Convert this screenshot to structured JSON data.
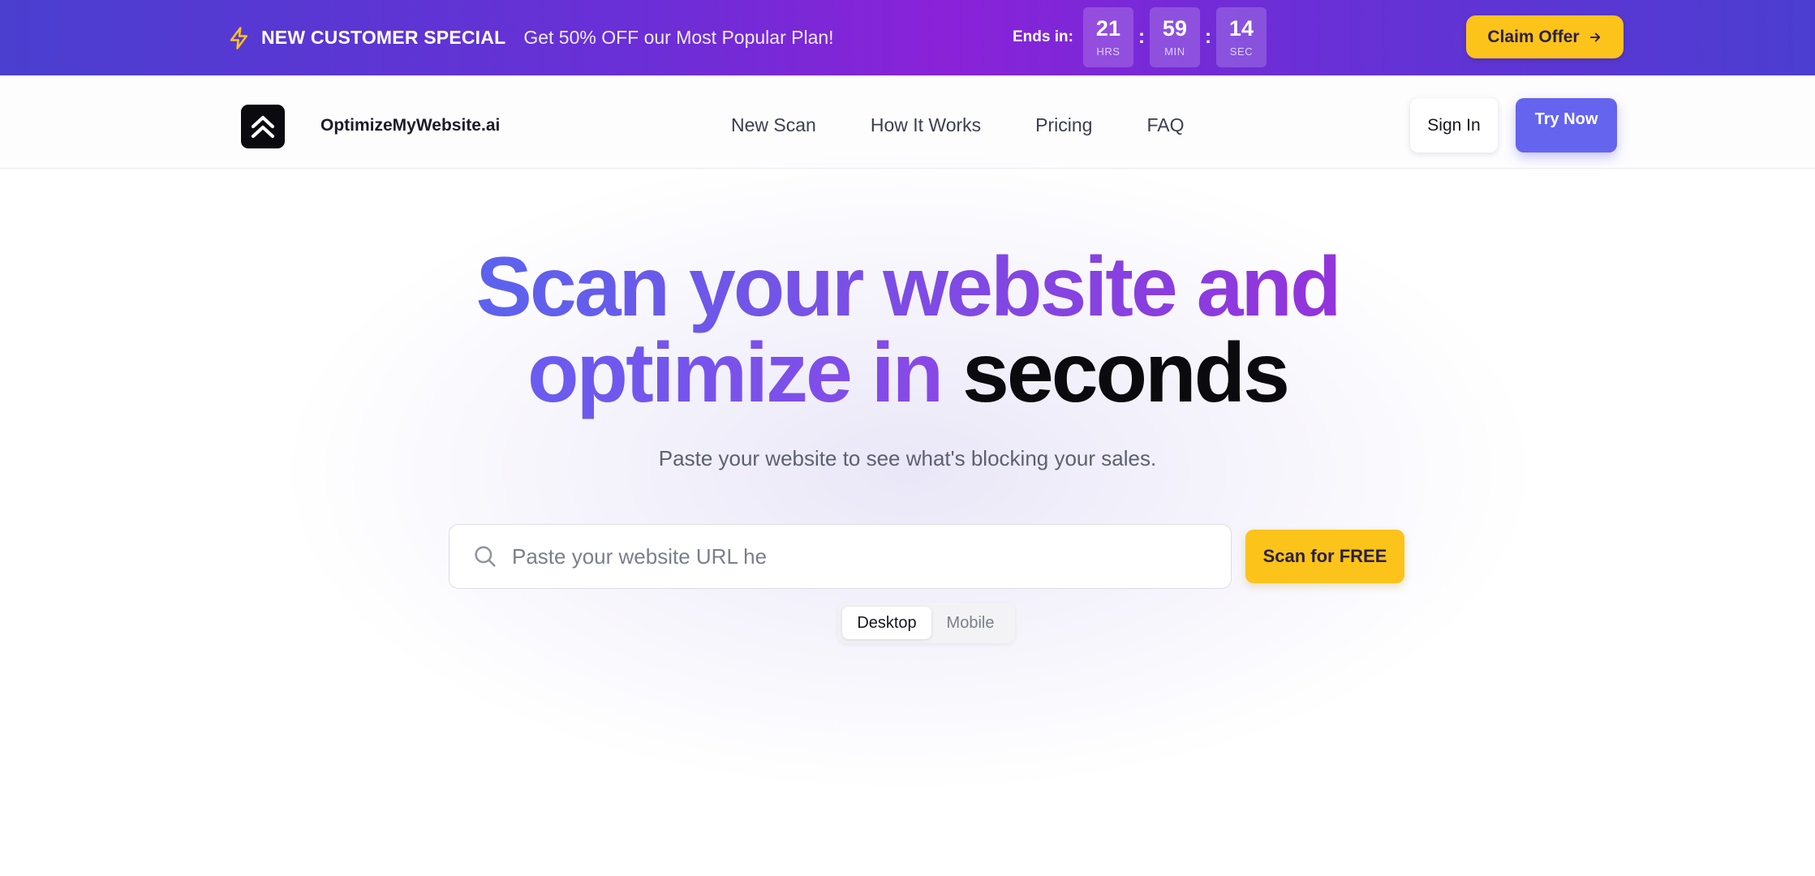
{
  "promo": {
    "tag": "NEW CUSTOMER SPECIAL",
    "text": "Get 50% OFF our Most Popular Plan!",
    "ends_label": "Ends in:",
    "countdown": [
      {
        "value": "21",
        "unit": "HRS"
      },
      {
        "value": "59",
        "unit": "MIN"
      },
      {
        "value": "14",
        "unit": "SEC"
      }
    ],
    "separator": ":",
    "cta_label": "Claim Offer",
    "icons": {
      "tag_icon": "lightning-bolt-icon",
      "cta_icon": "arrow-right-icon"
    }
  },
  "nav": {
    "brand": "OptimizeMyWebsite.ai",
    "logo_icon": "double-chevron-up-icon",
    "links": [
      "New Scan",
      "How It Works",
      "Pricing",
      "FAQ"
    ],
    "signin_label": "Sign In",
    "trynow_label": "Try Now"
  },
  "hero": {
    "headline_line1_a": "Scan your website and",
    "headline_line2_a": "optimize in",
    "headline_line2_b": "seconds",
    "subhead": "Paste your website to see what's blocking your sales.",
    "search": {
      "placeholder": "Paste your website URL he",
      "value": "",
      "icon": "search-icon"
    },
    "scan_label": "Scan for FREE",
    "device_options": [
      "Desktop",
      "Mobile"
    ],
    "device_selected": "Desktop"
  },
  "colors": {
    "accent_purple": "#6464ef",
    "cta_yellow": "#fcc31a",
    "headline_gradient": [
      "#5b63ee",
      "#9333dc"
    ]
  }
}
